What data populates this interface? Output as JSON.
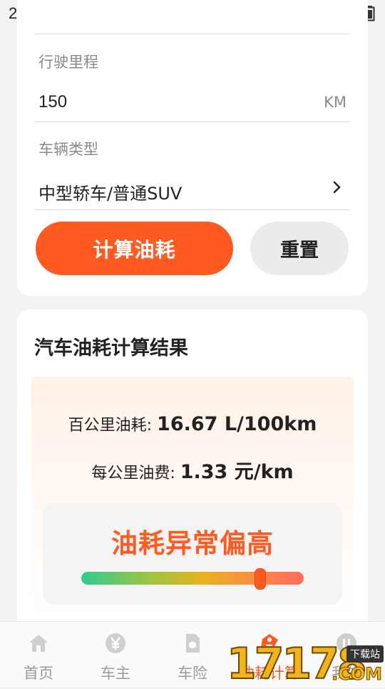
{
  "status": {
    "time": "2:26",
    "extra": "2"
  },
  "form": {
    "mileage_label": "行驶里程",
    "mileage_value": "150",
    "mileage_unit": "KM",
    "vehicle_label": "车辆类型",
    "vehicle_value": "中型轿车/普通SUV",
    "calc_button": "计算油耗",
    "reset_button": "重置"
  },
  "result": {
    "title": "汽车油耗计算结果",
    "per100_label": "百公里油耗: ",
    "per100_value": "16.67 L/100km",
    "perkm_label": "每公里油费: ",
    "perkm_value": "1.33 元/km",
    "level": "油耗异常偏高",
    "gauge_fraction": 0.8
  },
  "nav": [
    {
      "label": "首页",
      "icon": "home-icon"
    },
    {
      "label": "车主",
      "icon": "yen-coin-icon"
    },
    {
      "label": "车险",
      "icon": "insurance-doc-icon"
    },
    {
      "label": "油耗计算",
      "icon": "fuel-tag-icon",
      "active": true
    },
    {
      "label": "我的",
      "icon": "profile-icon"
    }
  ],
  "watermark": {
    "brand": "17178",
    "tag": "下载站",
    "suffix": ".COM"
  },
  "colors": {
    "accent": "#ff5a1f"
  }
}
